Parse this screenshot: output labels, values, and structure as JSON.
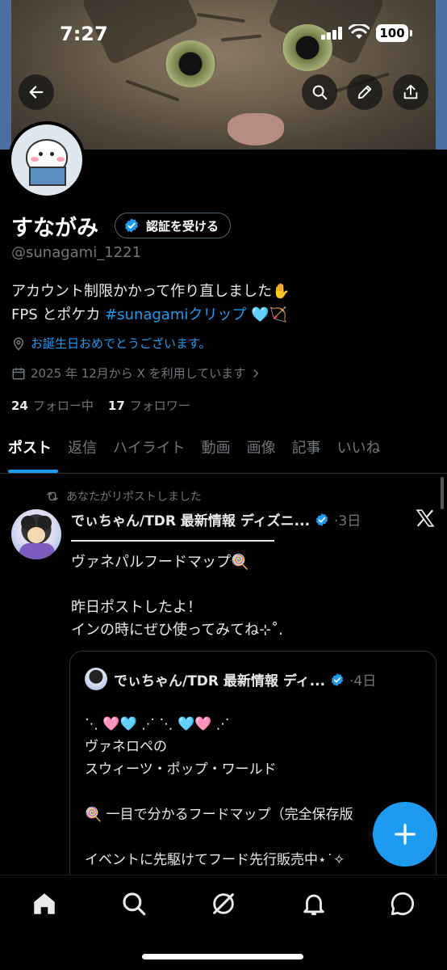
{
  "status_bar": {
    "time": "7:27",
    "battery": "100"
  },
  "profile": {
    "name": "すながみ",
    "verify_label": "認証を受ける",
    "handle": "@sunagami_1221",
    "bio_line1": "アカウント制限かかって作り直しました✋",
    "bio_line2_prefix": "FPS とポケカ ",
    "bio_hashtag": "#sunagamiクリップ",
    "bio_line2_suffix": " 🩵🏹",
    "birthday": "お誕生日おめでとうございます。",
    "joined": "2025 年 12月から X を利用しています",
    "following_count": "24",
    "following_label": "フォロー中",
    "followers_count": "17",
    "followers_label": "フォロワー"
  },
  "tabs": [
    {
      "label": "ポスト",
      "active": true
    },
    {
      "label": "返信"
    },
    {
      "label": "ハイライト"
    },
    {
      "label": "動画"
    },
    {
      "label": "画像"
    },
    {
      "label": "記事"
    },
    {
      "label": "いいね"
    }
  ],
  "post": {
    "repost_note": "あなたがリポストしました",
    "author": "でぃちゃん/TDR 最新情報 ディズニ...",
    "time_ago": "·3日",
    "body": "ヴァネパルフードマップ🍭\n\n昨日ポストしたよ！\nインの時にぜひ使ってみてね⊹˚."
  },
  "quote": {
    "author": "でぃちゃん/TDR 最新情報 ディ...",
    "time_ago": "·4日",
    "body": "⋱ 🩷🩵 ⋰              ⋱ 🩵🩷 ⋰\nヴァネロペの\nスウィーツ・ポップ・ワールド\n\n🍭 一目で分かるフードマップ（完全保存版\n\nイベントに先駆けてフード先行販売中⋆˙✧\nおすぃーつモチーフの世界を楽しむならぜ"
  },
  "icons": {
    "back": "back-arrow-icon",
    "search": "search-icon",
    "edit": "pencil-icon",
    "share": "share-icon",
    "compose": "plus-icon",
    "nav": [
      "home-icon",
      "search-icon",
      "grok-icon",
      "bell-icon",
      "messages-icon"
    ]
  },
  "colors": {
    "accent": "#1d9bf0",
    "background": "#000000",
    "muted": "#71767b",
    "text": "#e7e9ea"
  }
}
